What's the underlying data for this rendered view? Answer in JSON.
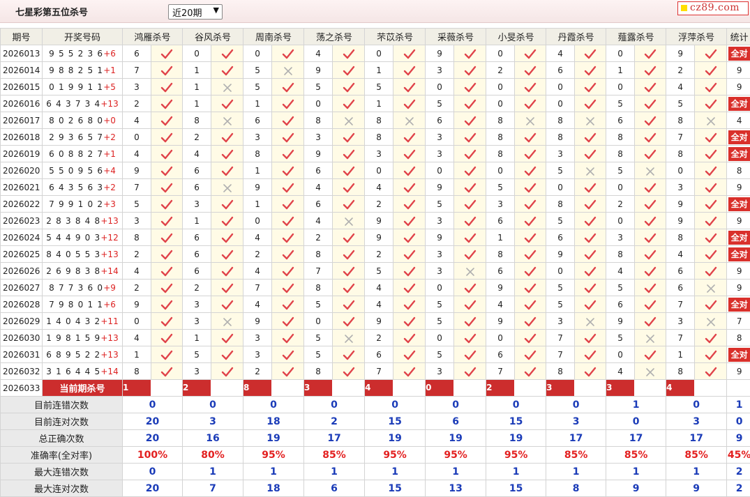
{
  "header": {
    "title": "七星彩第五位杀号",
    "period_selected": "近20期",
    "logo_text": "cz89.com"
  },
  "columns": {
    "issue": "期号",
    "draw": "开奖号码",
    "experts": [
      "鸿雁杀号",
      "谷风杀号",
      "周南杀号",
      "荡之杀号",
      "芣苡杀号",
      "采薇杀号",
      "小旻杀号",
      "丹霞杀号",
      "薤露杀号",
      "浮萍杀号"
    ],
    "stat": "统计"
  },
  "rows": [
    {
      "issue": "2026013",
      "draw": "9 5 5 2 3 6",
      "sum": "+6",
      "kills": [
        "6",
        "0",
        "0",
        "4",
        "0",
        "9",
        "0",
        "4",
        "0",
        "9"
      ],
      "hits": [
        1,
        1,
        1,
        1,
        1,
        1,
        1,
        1,
        1,
        1
      ],
      "stat": "全对"
    },
    {
      "issue": "2026014",
      "draw": "9 8 8 2 5 1",
      "sum": "+1",
      "kills": [
        "7",
        "1",
        "5",
        "9",
        "1",
        "3",
        "2",
        "6",
        "1",
        "2"
      ],
      "hits": [
        1,
        1,
        0,
        1,
        1,
        1,
        1,
        1,
        1,
        1
      ],
      "stat": "9"
    },
    {
      "issue": "2026015",
      "draw": "0 1 9 9 1 1",
      "sum": "+5",
      "kills": [
        "3",
        "1",
        "5",
        "5",
        "5",
        "0",
        "0",
        "0",
        "0",
        "4"
      ],
      "hits": [
        1,
        0,
        1,
        1,
        1,
        1,
        1,
        1,
        1,
        1
      ],
      "stat": "9"
    },
    {
      "issue": "2026016",
      "draw": "6 4 3 7 3 4",
      "sum": "+13",
      "kills": [
        "2",
        "1",
        "1",
        "0",
        "1",
        "5",
        "0",
        "0",
        "5",
        "5"
      ],
      "hits": [
        1,
        1,
        1,
        1,
        1,
        1,
        1,
        1,
        1,
        1
      ],
      "stat": "全对"
    },
    {
      "issue": "2026017",
      "draw": "8 0 2 6 8 0",
      "sum": "+0",
      "kills": [
        "4",
        "8",
        "6",
        "8",
        "8",
        "6",
        "8",
        "8",
        "6",
        "8"
      ],
      "hits": [
        1,
        0,
        1,
        0,
        0,
        1,
        0,
        0,
        1,
        0
      ],
      "stat": "4"
    },
    {
      "issue": "2026018",
      "draw": "2 9 3 6 5 7",
      "sum": "+2",
      "kills": [
        "0",
        "2",
        "3",
        "3",
        "8",
        "3",
        "8",
        "8",
        "8",
        "7"
      ],
      "hits": [
        1,
        1,
        1,
        1,
        1,
        1,
        1,
        1,
        1,
        1
      ],
      "stat": "全对"
    },
    {
      "issue": "2026019",
      "draw": "6 0 8 8 2 7",
      "sum": "+1",
      "kills": [
        "4",
        "4",
        "8",
        "9",
        "3",
        "3",
        "8",
        "3",
        "8",
        "8"
      ],
      "hits": [
        1,
        1,
        1,
        1,
        1,
        1,
        1,
        1,
        1,
        1
      ],
      "stat": "全对"
    },
    {
      "issue": "2026020",
      "draw": "5 5 0 9 5 6",
      "sum": "+4",
      "kills": [
        "9",
        "6",
        "1",
        "6",
        "0",
        "0",
        "0",
        "5",
        "5",
        "0"
      ],
      "hits": [
        1,
        1,
        1,
        1,
        1,
        1,
        1,
        0,
        0,
        1
      ],
      "stat": "8"
    },
    {
      "issue": "2026021",
      "draw": "6 4 3 5 6 3",
      "sum": "+2",
      "kills": [
        "7",
        "6",
        "9",
        "4",
        "4",
        "9",
        "5",
        "0",
        "0",
        "3"
      ],
      "hits": [
        1,
        0,
        1,
        1,
        1,
        1,
        1,
        1,
        1,
        1
      ],
      "stat": "9"
    },
    {
      "issue": "2026022",
      "draw": "7 9 9 1 0 2",
      "sum": "+3",
      "kills": [
        "5",
        "3",
        "1",
        "6",
        "2",
        "5",
        "3",
        "8",
        "2",
        "9"
      ],
      "hits": [
        1,
        1,
        1,
        1,
        1,
        1,
        1,
        1,
        1,
        1
      ],
      "stat": "全对"
    },
    {
      "issue": "2026023",
      "draw": "2 8 3 8 4 8",
      "sum": "+13",
      "kills": [
        "3",
        "1",
        "0",
        "4",
        "9",
        "3",
        "6",
        "5",
        "0",
        "9"
      ],
      "hits": [
        1,
        1,
        1,
        0,
        1,
        1,
        1,
        1,
        1,
        1
      ],
      "stat": "9"
    },
    {
      "issue": "2026024",
      "draw": "5 4 4 9 0 3",
      "sum": "+12",
      "kills": [
        "8",
        "6",
        "4",
        "2",
        "9",
        "9",
        "1",
        "6",
        "3",
        "8"
      ],
      "hits": [
        1,
        1,
        1,
        1,
        1,
        1,
        1,
        1,
        1,
        1
      ],
      "stat": "全对"
    },
    {
      "issue": "2026025",
      "draw": "8 4 0 5 5 3",
      "sum": "+13",
      "kills": [
        "2",
        "6",
        "2",
        "8",
        "2",
        "3",
        "8",
        "9",
        "8",
        "4"
      ],
      "hits": [
        1,
        1,
        1,
        1,
        1,
        1,
        1,
        1,
        1,
        1
      ],
      "stat": "全对"
    },
    {
      "issue": "2026026",
      "draw": "2 6 9 8 3 8",
      "sum": "+14",
      "kills": [
        "4",
        "6",
        "4",
        "7",
        "5",
        "3",
        "6",
        "0",
        "4",
        "6"
      ],
      "hits": [
        1,
        1,
        1,
        1,
        1,
        0,
        1,
        1,
        1,
        1
      ],
      "stat": "9"
    },
    {
      "issue": "2026027",
      "draw": "8 7 7 3 6 0",
      "sum": "+9",
      "kills": [
        "2",
        "2",
        "7",
        "8",
        "4",
        "0",
        "9",
        "5",
        "5",
        "6"
      ],
      "hits": [
        1,
        1,
        1,
        1,
        1,
        1,
        1,
        1,
        1,
        0
      ],
      "stat": "9"
    },
    {
      "issue": "2026028",
      "draw": "7 9 8 0 1 1",
      "sum": "+6",
      "kills": [
        "9",
        "3",
        "4",
        "5",
        "4",
        "5",
        "4",
        "5",
        "6",
        "7"
      ],
      "hits": [
        1,
        1,
        1,
        1,
        1,
        1,
        1,
        1,
        1,
        1
      ],
      "stat": "全对"
    },
    {
      "issue": "2026029",
      "draw": "1 4 0 4 3 2",
      "sum": "+11",
      "kills": [
        "0",
        "3",
        "9",
        "0",
        "9",
        "5",
        "9",
        "3",
        "9",
        "3"
      ],
      "hits": [
        1,
        0,
        1,
        1,
        1,
        1,
        1,
        0,
        1,
        0
      ],
      "stat": "7"
    },
    {
      "issue": "2026030",
      "draw": "1 9 8 1 5 9",
      "sum": "+13",
      "kills": [
        "4",
        "1",
        "3",
        "5",
        "2",
        "0",
        "0",
        "7",
        "5",
        "7"
      ],
      "hits": [
        1,
        1,
        1,
        0,
        1,
        1,
        1,
        1,
        0,
        1
      ],
      "stat": "8"
    },
    {
      "issue": "2026031",
      "draw": "6 8 9 5 2 2",
      "sum": "+13",
      "kills": [
        "1",
        "5",
        "3",
        "5",
        "6",
        "5",
        "6",
        "7",
        "0",
        "1"
      ],
      "hits": [
        1,
        1,
        1,
        1,
        1,
        1,
        1,
        1,
        1,
        1
      ],
      "stat": "全对"
    },
    {
      "issue": "2026032",
      "draw": "3 1 6 4 4 5",
      "sum": "+14",
      "kills": [
        "8",
        "3",
        "2",
        "8",
        "7",
        "3",
        "7",
        "8",
        "4",
        "8"
      ],
      "hits": [
        1,
        1,
        1,
        1,
        1,
        1,
        1,
        1,
        0,
        1
      ],
      "stat": "9"
    }
  ],
  "current": {
    "issue": "2026033",
    "label": "当前期杀号",
    "kills": [
      "1",
      "2",
      "8",
      "3",
      "4",
      "0",
      "2",
      "3",
      "3",
      "4"
    ]
  },
  "summary": [
    {
      "label": "目前连错次数",
      "values": [
        "0",
        "0",
        "0",
        "0",
        "0",
        "0",
        "0",
        "0",
        "1",
        "0"
      ],
      "stat": "1",
      "style": "val"
    },
    {
      "label": "目前连对次数",
      "values": [
        "20",
        "3",
        "18",
        "2",
        "15",
        "6",
        "15",
        "3",
        "0",
        "3"
      ],
      "stat": "0",
      "style": "val"
    },
    {
      "label": "总正确次数",
      "values": [
        "20",
        "16",
        "19",
        "17",
        "19",
        "19",
        "19",
        "17",
        "17",
        "17"
      ],
      "stat": "9",
      "style": "val"
    },
    {
      "label": "准确率(全对率)",
      "values": [
        "100%",
        "80%",
        "95%",
        "85%",
        "95%",
        "95%",
        "95%",
        "85%",
        "85%",
        "85%"
      ],
      "stat": "45%",
      "style": "rate"
    },
    {
      "label": "最大连错次数",
      "values": [
        "0",
        "1",
        "1",
        "1",
        "1",
        "1",
        "1",
        "1",
        "1",
        "1"
      ],
      "stat": "2",
      "style": "val"
    },
    {
      "label": "最大连对次数",
      "values": [
        "20",
        "7",
        "18",
        "6",
        "15",
        "13",
        "15",
        "8",
        "9",
        "9"
      ],
      "stat": "2",
      "style": "val"
    }
  ],
  "colors": {
    "accent_red": "#cc2d2d",
    "check": "#e0434a",
    "cross": "#b0b0b0",
    "value_blue": "#1a3bb8"
  },
  "icons": {
    "hit": "check-icon",
    "miss": "cross-icon"
  }
}
